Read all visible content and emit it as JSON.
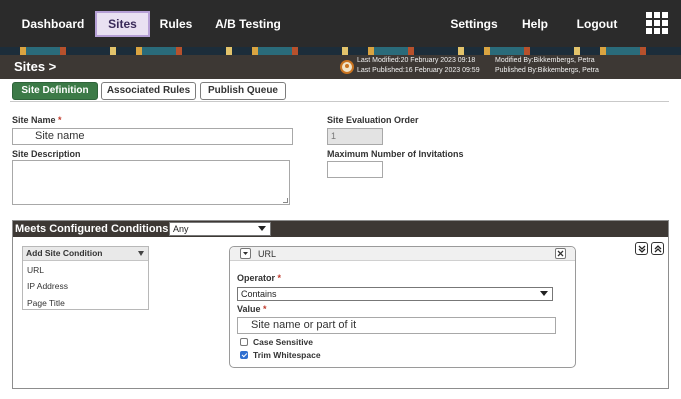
{
  "nav": {
    "dashboard": "Dashboard",
    "sites": "Sites",
    "rules": "Rules",
    "ab_testing": "A/B Testing",
    "settings": "Settings",
    "help": "Help",
    "logout": "Logout",
    "apps_icon": "grid-icon"
  },
  "header": {
    "breadcrumb": "Sites >",
    "last_modified": "Last Modified:20 February 2023 09:18",
    "last_published": "Last Published:16 February 2023 09:59",
    "modified_by": "Modified By:Bikkembergs, Petra",
    "published_by": "Published By:Bikkembergs, Petra"
  },
  "tabs": [
    {
      "label": "Site Definition",
      "active": true
    },
    {
      "label": "Associated Rules",
      "active": false
    },
    {
      "label": "Publish Queue",
      "active": false
    }
  ],
  "form": {
    "site_name_label": "Site Name",
    "required_mark": "*",
    "site_name_value": "Site name",
    "site_description_label": "Site Description",
    "site_description_value": "",
    "eval_order_label": "Site Evaluation Order",
    "eval_order_value": "1",
    "max_invitations_label": "Maximum Number of Invitations",
    "max_invitations_value": ""
  },
  "conditions": {
    "title": "Meets Configured Conditions",
    "match_value": "Any",
    "add_condition_label": "Add Site Condition",
    "options": [
      "URL",
      "IP Address",
      "Page Title"
    ],
    "panel": {
      "title": "URL",
      "operator_label": "Operator",
      "operator_value": "Contains",
      "value_label": "Value",
      "value_placeholder": "Site name or part of it",
      "case_sensitive_label": "Case Sensitive",
      "case_sensitive_checked": false,
      "trim_whitespace_label": "Trim Whitespace",
      "trim_whitespace_checked": true
    }
  },
  "colors": {
    "nav_bg": "#2b2b2b",
    "header_bg": "#3d3834",
    "active_tab": "#3c7a47",
    "active_nav": "#e9e1f2",
    "required": "#c0392b"
  }
}
